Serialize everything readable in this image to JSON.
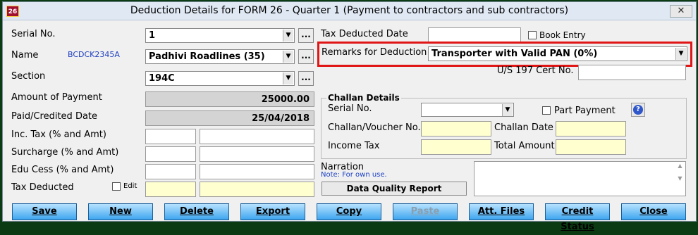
{
  "window": {
    "app_icon_text": "26",
    "title": "Deduction Details for FORM 26 - Quarter 1 (Payment to contractors and sub contractors)",
    "close_glyph": "✕"
  },
  "left": {
    "serial_no": {
      "label": "Serial No.",
      "value": "1"
    },
    "name": {
      "label": "Name",
      "code": "BCDCK2345A",
      "value": "Padhivi Roadlines (35)"
    },
    "section": {
      "label": "Section",
      "value": "194C"
    },
    "amount_of_payment": {
      "label": "Amount of Payment",
      "value": "25000.00"
    },
    "paid_credited_date": {
      "label": "Paid/Credited Date",
      "value": "25/04/2018"
    },
    "inc_tax": {
      "label": "Inc. Tax (% and Amt)"
    },
    "surcharge": {
      "label": "Surcharge (% and Amt)"
    },
    "edu_cess": {
      "label": "Edu Cess (% and Amt)"
    },
    "tax_deducted": {
      "label": "Tax Deducted",
      "edit_label": "Edit"
    },
    "dots": "..."
  },
  "right": {
    "tax_deducted_date": {
      "label": "Tax Deducted Date",
      "value": ""
    },
    "book_entry_label": "Book Entry",
    "remarks": {
      "label": "Remarks for Deduction",
      "value": "Transporter with Valid PAN (0%)"
    },
    "cert_no": {
      "label": "U/S 197 Cert No."
    },
    "challan": {
      "title": "Challan Details",
      "serial_label": "Serial No.",
      "part_payment_label": "Part Payment",
      "voucher_label": "Challan/Voucher No.",
      "date_label": "Challan Date",
      "income_tax_label": "Income Tax",
      "total_amount_label": "Total Amount"
    },
    "narration": {
      "label": "Narration",
      "note": "Note: For own use."
    },
    "dqr_label": "Data Quality Report"
  },
  "buttons": [
    "Save",
    "New",
    "Delete",
    "Export",
    "Copy",
    "Paste",
    "Att. Files",
    "Credit Status",
    "Close"
  ],
  "colors": {
    "highlight": "#e01616",
    "button": "#3ea6ef",
    "readonly": "#d4d4d4",
    "yellow_field": "#ffffd0"
  }
}
